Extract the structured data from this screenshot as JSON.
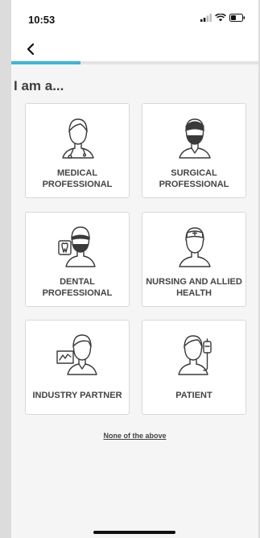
{
  "status": {
    "time": "10:53"
  },
  "header": {
    "title": "I am a..."
  },
  "progress": {
    "fraction": 0.28,
    "color": "#3bb6d8"
  },
  "options": [
    {
      "label": "MEDICAL PROFESSIONAL",
      "icon": "doctor-stethoscope-icon"
    },
    {
      "label": "SURGICAL PROFESSIONAL",
      "icon": "surgeon-mask-icon"
    },
    {
      "label": "DENTAL PROFESSIONAL",
      "icon": "dentist-tooth-icon"
    },
    {
      "label": "NURSING AND ALLIED HEALTH",
      "icon": "nurse-cap-icon"
    },
    {
      "label": "INDUSTRY PARTNER",
      "icon": "industry-chart-icon"
    },
    {
      "label": "PATIENT",
      "icon": "patient-iv-drip-icon"
    }
  ],
  "footer": {
    "none_link": "None of the above"
  }
}
